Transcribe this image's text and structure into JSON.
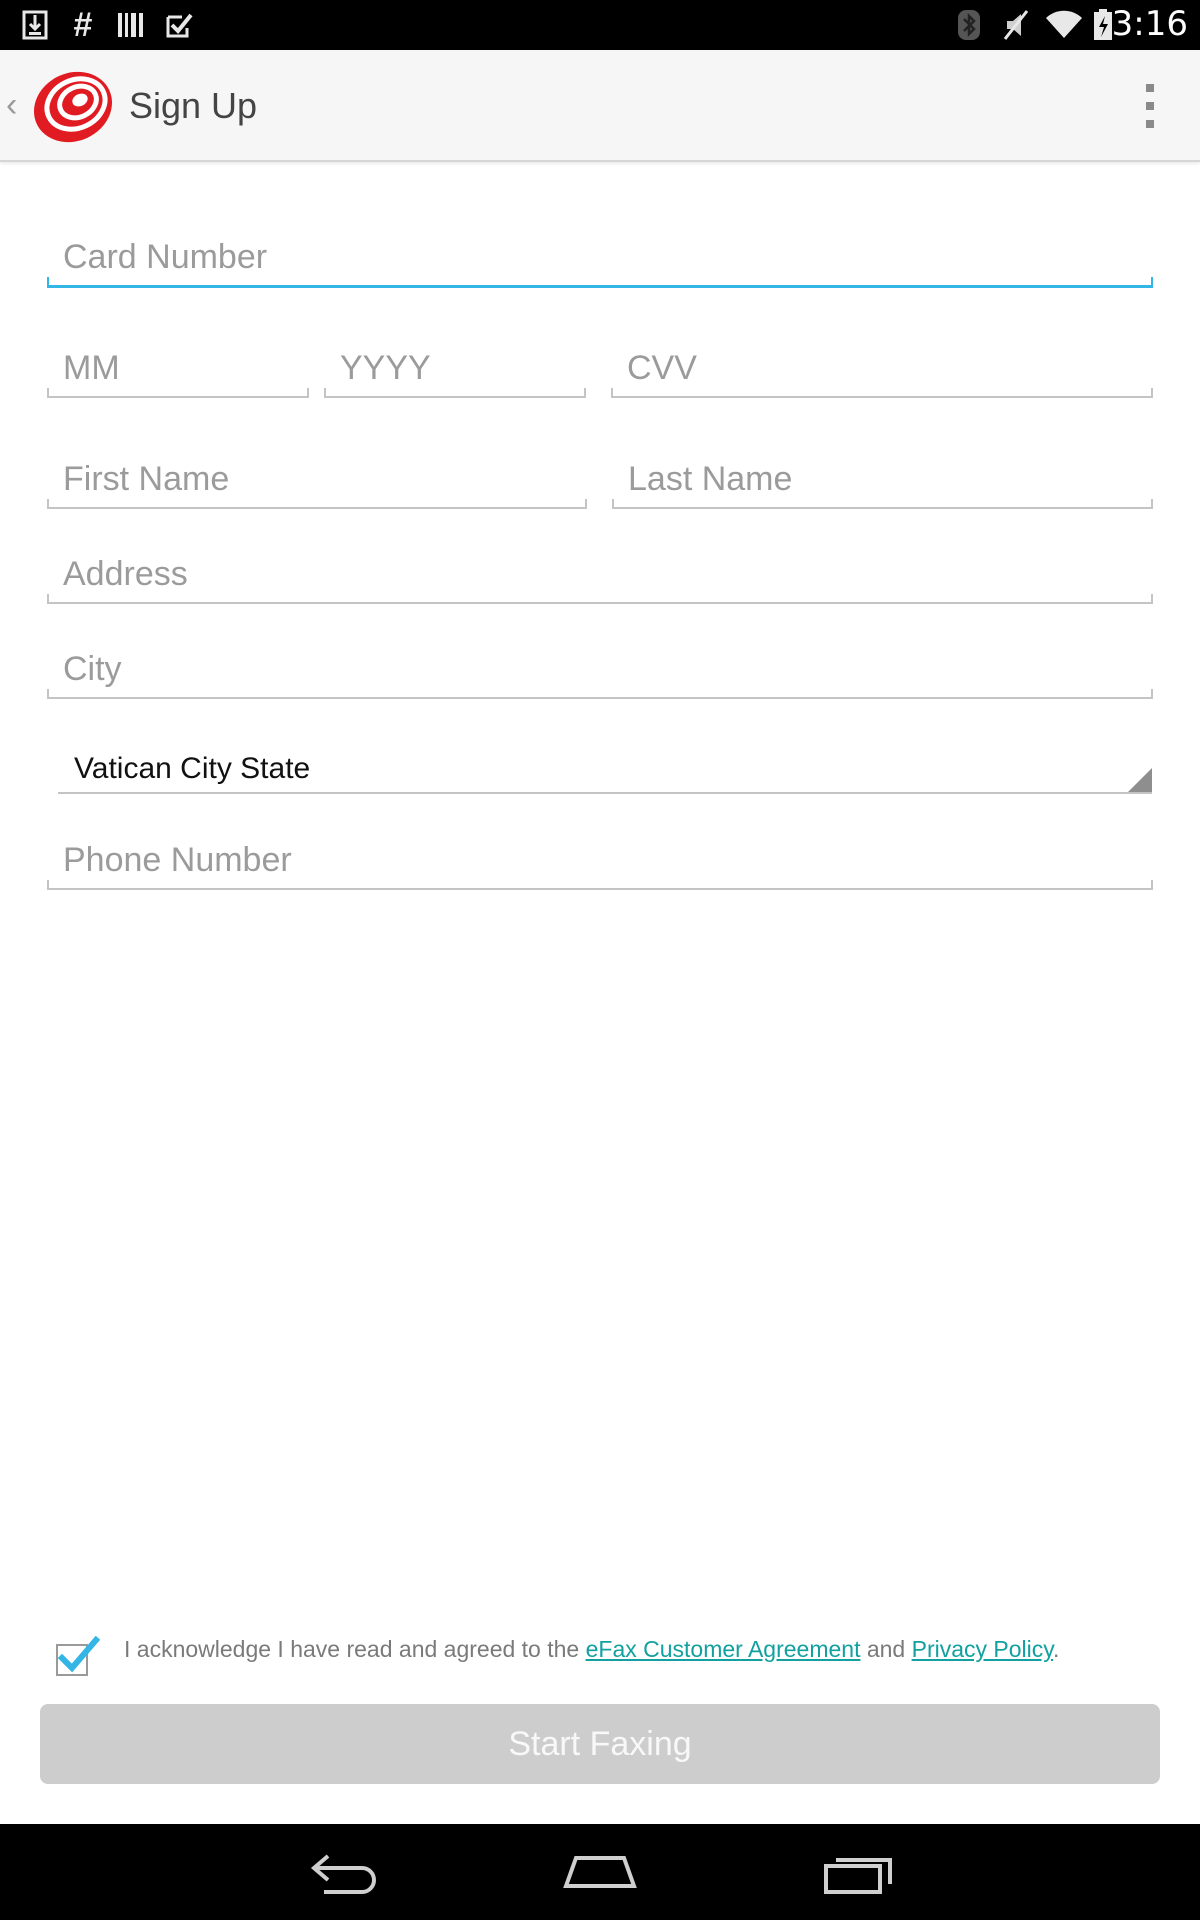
{
  "status_bar": {
    "time": "3:16",
    "left_icons": [
      "download-icon",
      "hash-icon",
      "barcode-icon",
      "checkbox-icon"
    ],
    "right_icons": [
      "bluetooth-icon",
      "mute-icon",
      "wifi-icon",
      "battery-charging-icon"
    ]
  },
  "action_bar": {
    "title": "Sign Up",
    "logo": "efax-spiral-logo",
    "overflow_icon": "overflow-menu-icon"
  },
  "form": {
    "card_number": {
      "placeholder": "Card Number",
      "value": ""
    },
    "month": {
      "placeholder": "MM",
      "value": ""
    },
    "year": {
      "placeholder": "YYYY",
      "value": ""
    },
    "cvv": {
      "placeholder": "CVV",
      "value": ""
    },
    "first_name": {
      "placeholder": "First Name",
      "value": ""
    },
    "last_name": {
      "placeholder": "Last Name",
      "value": ""
    },
    "address": {
      "placeholder": "Address",
      "value": ""
    },
    "city": {
      "placeholder": "City",
      "value": ""
    },
    "country": {
      "selected": "Vatican City State"
    },
    "phone": {
      "placeholder": "Phone Number",
      "value": ""
    }
  },
  "agreement": {
    "checked": true,
    "text_before": "I acknowledge I have read and agreed to the ",
    "link1": "eFax Customer Agreement",
    "text_between": " and ",
    "link2": "Privacy Policy",
    "text_after": "."
  },
  "start_button": {
    "label": "Start Faxing",
    "enabled": false
  },
  "nav_bar": {
    "icons": [
      "back-icon",
      "home-icon",
      "recents-icon"
    ]
  },
  "colors": {
    "focus_accent": "#33b5e5",
    "link": "#12a0a0",
    "logo_red": "#e11b22",
    "disabled_button": "#cdcdcd"
  }
}
